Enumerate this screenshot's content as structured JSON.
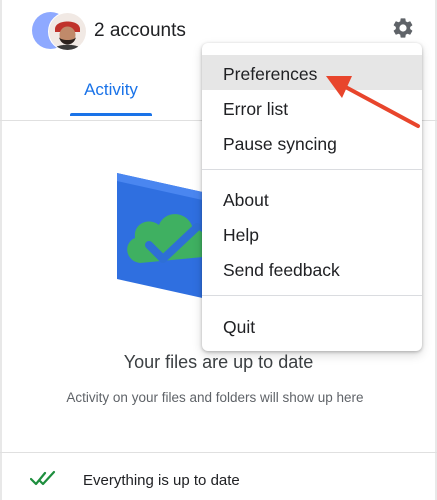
{
  "header": {
    "accounts_label": "2 accounts",
    "avatar_icon": "account-avatar",
    "settings_icon": "gear-icon"
  },
  "tabs": [
    {
      "label": "Activity",
      "active": true
    }
  ],
  "main": {
    "illustration_icon": "cloud-check-folder",
    "status_title": "Your files are up to date",
    "status_subtitle": "Activity on your files and folders will show up here"
  },
  "footer": {
    "icon": "double-check-icon",
    "text": "Everything is up to date"
  },
  "menu": {
    "items": [
      {
        "label": "Preferences",
        "highlighted": true
      },
      {
        "label": "Error list"
      },
      {
        "label": "Pause syncing"
      },
      {
        "label": "About"
      },
      {
        "label": "Help"
      },
      {
        "label": "Send feedback"
      },
      {
        "label": "Quit"
      }
    ]
  },
  "annotation": {
    "arrow_color": "#e8452c",
    "points_to": "Preferences"
  },
  "colors": {
    "accent": "#1a73e8",
    "check_green": "#1e8e3e",
    "menu_highlight": "#e6e6e6"
  }
}
